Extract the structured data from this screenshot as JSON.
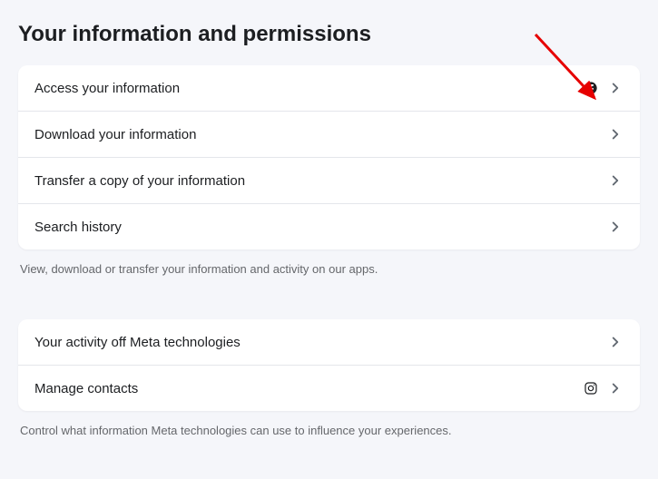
{
  "page": {
    "title": "Your information and permissions"
  },
  "section1": {
    "rows": [
      {
        "label": "Access your information",
        "platform_icon": "facebook"
      },
      {
        "label": "Download your information"
      },
      {
        "label": "Transfer a copy of your information"
      },
      {
        "label": "Search history"
      }
    ],
    "helper": "View, download or transfer your information and activity on our apps."
  },
  "section2": {
    "rows": [
      {
        "label": "Your activity off Meta technologies"
      },
      {
        "label": "Manage contacts",
        "platform_icon": "instagram"
      }
    ],
    "helper": "Control what information Meta technologies can use to influence your experiences."
  }
}
